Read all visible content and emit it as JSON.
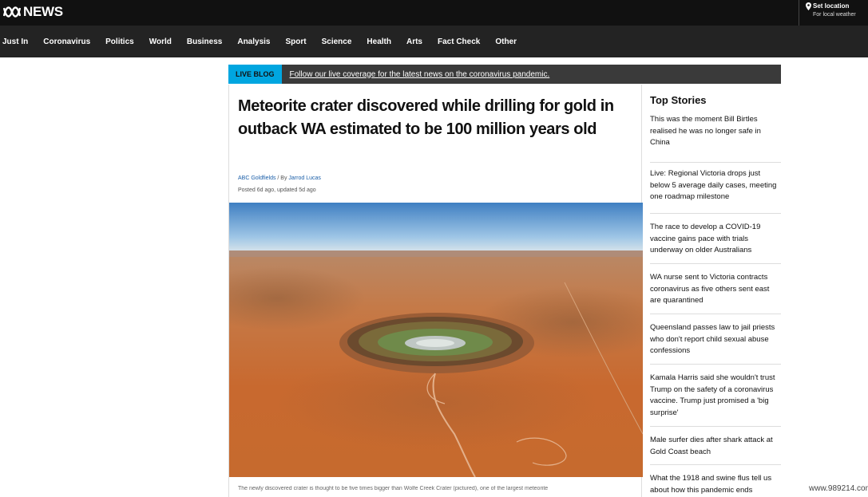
{
  "header": {
    "logo_text": "NEWS",
    "location_title": "Set location",
    "location_sub": "For local weather"
  },
  "nav": {
    "items": [
      "Just In",
      "Coronavirus",
      "Politics",
      "World",
      "Business",
      "Analysis",
      "Sport",
      "Science",
      "Health",
      "Arts",
      "Fact Check",
      "Other"
    ]
  },
  "live_blog": {
    "badge": "LIVE BLOG",
    "text": "Follow our live coverage for the latest news on the coronavirus pandemic."
  },
  "article": {
    "headline": "Meteorite crater discovered while drilling for gold in outback WA estimated to be 100 million years old",
    "source": "ABC Goldfields",
    "by_prefix": " / By ",
    "author": "Jarrod Lucas",
    "timestamp": "Posted 6d ago, updated 5d ago",
    "caption": "The newly discovered crater is thought to be five times bigger than Wolfe Creek Crater (pictured), one of the largest meteorite"
  },
  "sidebar": {
    "title": "Top Stories",
    "stories": [
      "This was the moment Bill Birtles realised he was no longer safe in China",
      "Live: Regional Victoria drops just below 5 average daily cases, meeting one roadmap milestone",
      "The race to develop a COVID-19 vaccine gains pace with trials underway on older Australians",
      "WA nurse sent to Victoria contracts coronavirus as five others sent east are quarantined",
      "Queensland passes law to jail priests who don't report child sexual abuse confessions",
      "Kamala Harris said she wouldn't trust Trump on the safety of a coronavirus vaccine. Trump just promised a 'big surprise'",
      "Male surfer dies after shark attack at Gold Coast beach",
      "What the 1918 and swine flus tell us about how this pandemic ends"
    ]
  },
  "watermark": "www.989214.com",
  "colors": {
    "topbar": "#111111",
    "navbar": "#232323",
    "live_badge": "#00a6e0",
    "live_bar": "#3a3a3a",
    "link": "#1a5ea8"
  }
}
